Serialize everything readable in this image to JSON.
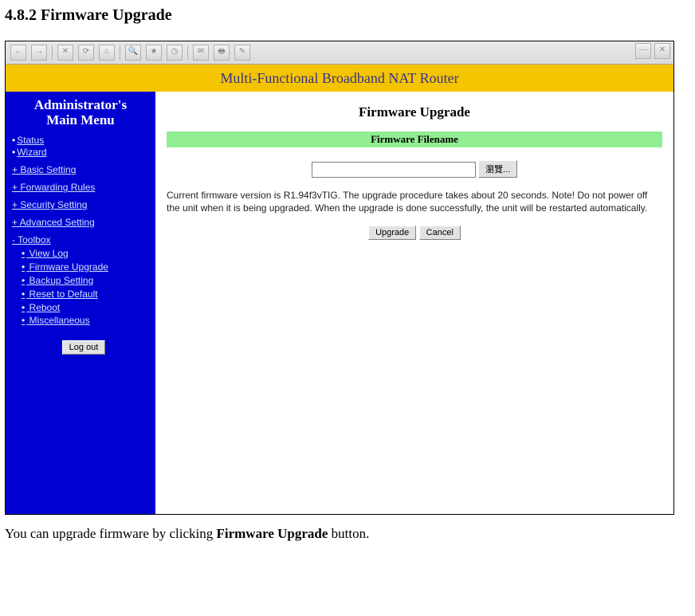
{
  "doc": {
    "heading": "4.8.2 Firmware Upgrade",
    "footer_pre": "You can upgrade firmware by clicking ",
    "footer_bold": "Firmware Upgrade",
    "footer_post": " button."
  },
  "banner": {
    "title": "Multi-Functional Broadband NAT Router"
  },
  "sidebar": {
    "title_line1": "Administrator's",
    "title_line2": "Main Menu",
    "top": [
      {
        "label": "Status"
      },
      {
        "label": "Wizard"
      }
    ],
    "sections": [
      {
        "label": "+ Basic Setting"
      },
      {
        "label": "+ Forwarding Rules"
      },
      {
        "label": "+ Security Setting"
      },
      {
        "label": "+ Advanced Setting"
      }
    ],
    "toolbox_label": "- Toolbox",
    "toolbox_items": [
      {
        "label": "View Log"
      },
      {
        "label": "Firmware Upgrade"
      },
      {
        "label": "Backup Setting"
      },
      {
        "label": "Reset to Default"
      },
      {
        "label": "Reboot"
      },
      {
        "label": "Miscellaneous"
      }
    ],
    "logout_label": "Log out"
  },
  "main": {
    "title": "Firmware Upgrade",
    "greenbar": "Firmware Filename",
    "browse_label": "瀏覽...",
    "info": "Current firmware version is R1.94f3vTIG. The upgrade procedure takes about 20 seconds. Note! Do not power off the unit when it is being upgraded. When the upgrade is done successfully, the unit will be restarted automatically.",
    "upgrade_label": "Upgrade",
    "cancel_label": "Cancel"
  }
}
